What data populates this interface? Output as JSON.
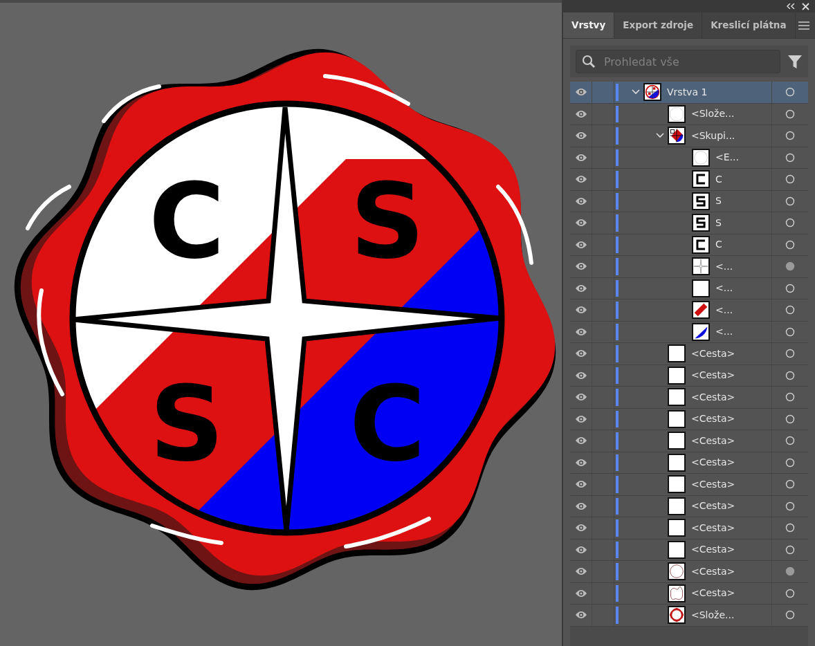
{
  "canvas": {
    "letters": [
      "C",
      "S",
      "S",
      "C"
    ]
  },
  "tabs": [
    {
      "label": "Vrstvy",
      "selected": true
    },
    {
      "label": "Export zdroje",
      "selected": false
    },
    {
      "label": "Kreslicí plátna",
      "selected": false
    }
  ],
  "search": {
    "placeholder": "Prohledat vše"
  },
  "layers": [
    {
      "name": "Vrstva 1",
      "kind": "seal",
      "visible": true,
      "expanded": true,
      "selected": true,
      "targeted": false,
      "children": [
        {
          "name": "<Slože...",
          "kind": "octagon",
          "visible": true,
          "selected": false,
          "targeted": false
        },
        {
          "name": "<Skupi...",
          "kind": "group",
          "visible": true,
          "expanded": true,
          "selected": false,
          "targeted": false,
          "children": [
            {
              "name": "<E...",
              "kind": "circle",
              "visible": true,
              "selected": false,
              "targeted": false
            },
            {
              "name": "C",
              "kind": "glyph-c",
              "visible": true,
              "selected": false,
              "targeted": false
            },
            {
              "name": "S",
              "kind": "glyph-s",
              "visible": true,
              "selected": false,
              "targeted": false
            },
            {
              "name": "S",
              "kind": "glyph-s",
              "visible": true,
              "selected": false,
              "targeted": false
            },
            {
              "name": "C",
              "kind": "glyph-c",
              "visible": true,
              "selected": false,
              "targeted": false
            },
            {
              "name": "<...",
              "kind": "star",
              "visible": true,
              "selected": false,
              "targeted": true
            },
            {
              "name": "<...",
              "kind": "blank",
              "visible": true,
              "selected": false,
              "targeted": false
            },
            {
              "name": "<...",
              "kind": "stripe",
              "visible": true,
              "selected": false,
              "targeted": false
            },
            {
              "name": "<...",
              "kind": "half",
              "visible": true,
              "selected": false,
              "targeted": false
            }
          ]
        },
        {
          "name": "<Cesta>",
          "kind": "blank",
          "visible": true,
          "selected": false,
          "targeted": false
        },
        {
          "name": "<Cesta>",
          "kind": "blank",
          "visible": true,
          "selected": false,
          "targeted": false
        },
        {
          "name": "<Cesta>",
          "kind": "blank",
          "visible": true,
          "selected": false,
          "targeted": false
        },
        {
          "name": "<Cesta>",
          "kind": "blank",
          "visible": true,
          "selected": false,
          "targeted": false
        },
        {
          "name": "<Cesta>",
          "kind": "blank",
          "visible": true,
          "selected": false,
          "targeted": false
        },
        {
          "name": "<Cesta>",
          "kind": "blank",
          "visible": true,
          "selected": false,
          "targeted": false
        },
        {
          "name": "<Cesta>",
          "kind": "blank",
          "visible": true,
          "selected": false,
          "targeted": false
        },
        {
          "name": "<Cesta>",
          "kind": "blank",
          "visible": true,
          "selected": false,
          "targeted": false
        },
        {
          "name": "<Cesta>",
          "kind": "blank",
          "visible": true,
          "selected": false,
          "targeted": false
        },
        {
          "name": "<Cesta>",
          "kind": "blank",
          "visible": true,
          "selected": false,
          "targeted": false
        },
        {
          "name": "<Cesta>",
          "kind": "ring",
          "visible": true,
          "selected": false,
          "targeted": true
        },
        {
          "name": "<Cesta>",
          "kind": "wavy",
          "visible": true,
          "selected": false,
          "targeted": false
        },
        {
          "name": "<Slože...",
          "kind": "annulus",
          "visible": true,
          "selected": false,
          "targeted": false
        }
      ]
    }
  ]
}
